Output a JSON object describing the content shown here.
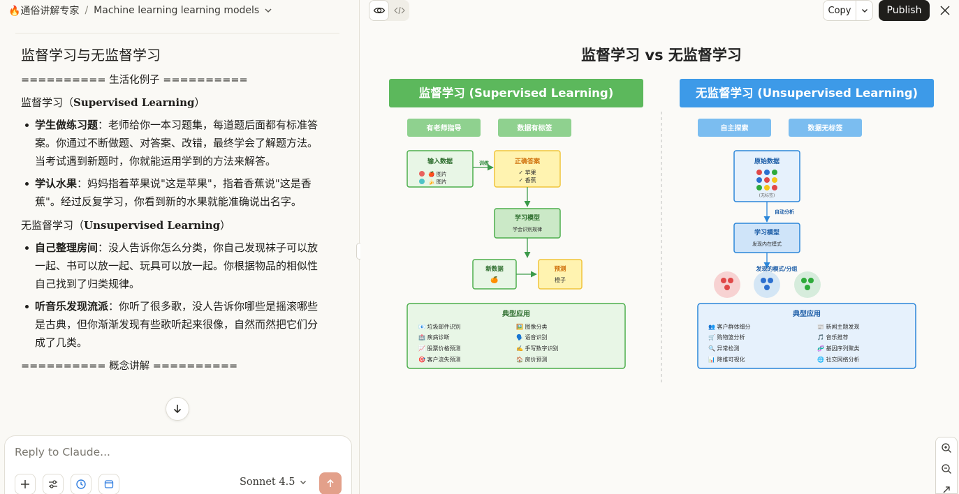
{
  "header": {
    "project": "🔥通俗讲解专家",
    "separator": "/",
    "conversation": "Machine learning learning models"
  },
  "chat": {
    "heading": "监督学习与无监督学习",
    "sep_examples": "========== 生活化例子 ==========",
    "sup_title_prefix": "监督学习（",
    "sup_title_en": "Supervised Learning",
    "sup_title_suffix": "）",
    "sup_items": [
      {
        "label": "学生做练习题",
        "text": "：老师给你一本习题集，每道题后面都有标准答案。你通过不断做题、对答案、改错，最终学会了解题方法。当考试遇到新题时，你就能运用学到的方法来解答。"
      },
      {
        "label": "学认水果",
        "text": "：妈妈指着苹果说\"这是苹果\"，指着香蕉说\"这是香蕉\"。经过反复学习，你看到新的水果就能准确说出名字。"
      }
    ],
    "unsup_title_prefix": "无监督学习（",
    "unsup_title_en": "Unsupervised Learning",
    "unsup_title_suffix": "）",
    "unsup_items": [
      {
        "label": "自己整理房间",
        "text": "：没人告诉你怎么分类，你自己发现袜子可以放一起、书可以放一起、玩具可以放一起。你根据物品的相似性自己找到了归类规律。"
      },
      {
        "label": "听音乐发现流派",
        "text": "：你听了很多歌，没人告诉你哪些是摇滚哪些是古典，但你渐渐发现有些歌听起来很像，自然而然把它们分成了几类。"
      }
    ],
    "sep_concepts": "========== 概念讲解 =========="
  },
  "composer": {
    "placeholder": "Reply to Claude...",
    "model": "Sonnet 4.5"
  },
  "artifact": {
    "copy_label": "Copy",
    "publish_label": "Publish"
  },
  "diagram": {
    "title": "监督学习 vs 无监督学习",
    "sup": {
      "header": "监督学习 (Supervised Learning)",
      "tag1": "有老师指导",
      "tag2": "数据有标签",
      "input_title": "输入数据",
      "input_row1": "🍎 图片",
      "input_row2": "🍌 图片",
      "train_label": "训练",
      "answer_title": "正确答案",
      "answer_row1": "✓ 苹果",
      "answer_row2": "✓ 香蕉",
      "model_title": "学习模型",
      "model_sub": "学会识别规律",
      "new_title": "新数据",
      "new_icon": "🍊",
      "pred_title": "预测",
      "pred_value": "橙子",
      "apps_title": "典型应用",
      "apps": [
        "📧 垃圾邮件识别",
        "🖼️ 图像分类",
        "🏥 疾病诊断",
        "🗣️ 语音识别",
        "📈 股票价格预测",
        "✍️ 手写数字识别",
        "🎯 客户流失预测",
        "🏠 房价预测"
      ]
    },
    "unsup": {
      "header": "无监督学习 (Unsupervised Learning)",
      "tag1": "自主探索",
      "tag2": "数据无标签",
      "raw_title": "原始数据",
      "raw_note": "(无标签)",
      "auto_label": "自动分析",
      "model_title": "学习模型",
      "model_sub": "发现内在模式",
      "found_label": "发现的模式/分组",
      "apps_title": "典型应用",
      "apps": [
        "👥 客户群体细分",
        "📰 新闻主题发现",
        "🛒 购物篮分析",
        "🎵 音乐推荐",
        "🔍 异常检测",
        "🧬 基因序列聚类",
        "📊 降维可视化",
        "🌐 社交网络分析"
      ]
    },
    "colors": {
      "sup_green": "#5cb85c",
      "unsup_blue": "#3d9ae8",
      "answer_yellow": "#fff3b0",
      "red_group": "#e04848",
      "blue_group": "#2b6fcf",
      "green_group": "#2eaa3a"
    }
  }
}
